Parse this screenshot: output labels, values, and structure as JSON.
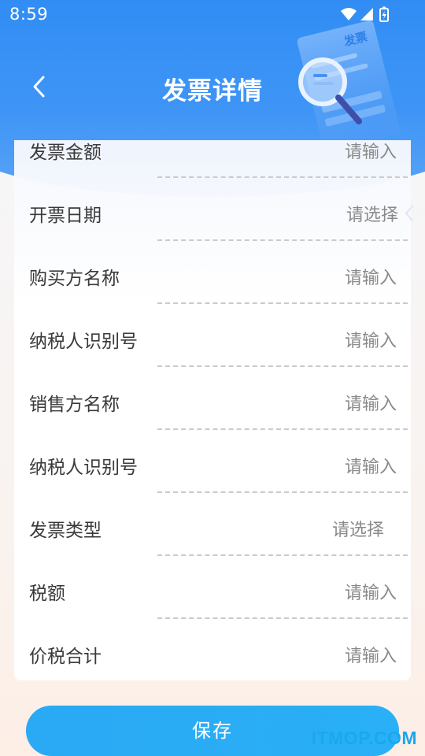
{
  "status_bar": {
    "time": "8:59",
    "icons": [
      "wifi-icon",
      "signal-icon",
      "battery-icon"
    ]
  },
  "header": {
    "title": "发票详情",
    "back_icon": "chevron-left-icon",
    "illustration_text": "发票"
  },
  "form": {
    "rows": [
      {
        "label": "发票金额",
        "value": "请输入",
        "kind": "input"
      },
      {
        "label": "开票日期",
        "value": "请选择",
        "kind": "select"
      },
      {
        "label": "购买方名称",
        "value": "请输入",
        "kind": "input"
      },
      {
        "label": "纳税人识别号",
        "value": "请输入",
        "kind": "input"
      },
      {
        "label": "销售方名称",
        "value": "请输入",
        "kind": "input"
      },
      {
        "label": "纳税人识别号",
        "value": "请输入",
        "kind": "input"
      },
      {
        "label": "发票类型",
        "value": "请选择",
        "kind": "select"
      },
      {
        "label": "税额",
        "value": "请输入",
        "kind": "input"
      },
      {
        "label": "价税合计",
        "value": "请输入",
        "kind": "input"
      }
    ]
  },
  "footer": {
    "save_label": "保存"
  },
  "watermark": "ITMOP.COM",
  "colors": {
    "header_blue": "#2f8cf4",
    "button_blue": "#2aa9f4",
    "watermark": "#19a8ee"
  }
}
